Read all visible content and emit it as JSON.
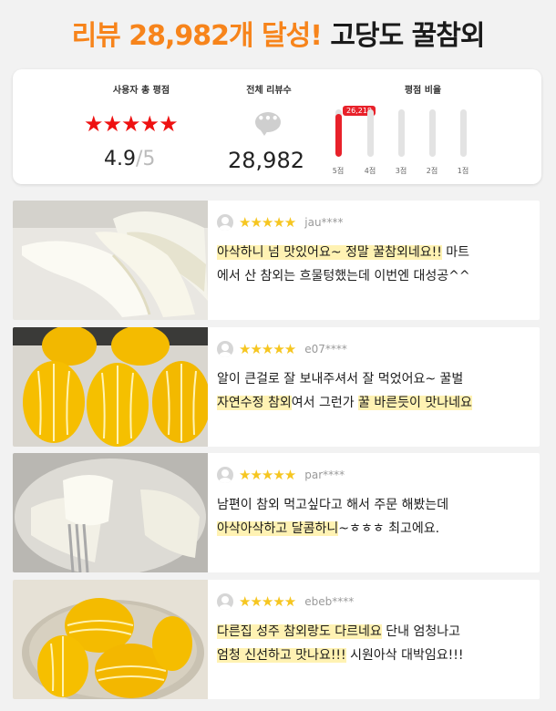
{
  "headline": {
    "accent": "리뷰 28,982개 달성!",
    "product": "고당도 꿀참외"
  },
  "summary": {
    "rating_title": "사용자 총 평점",
    "stars": "★★★★★",
    "score": "4.9",
    "score_max": "/5",
    "count_title": "전체 리뷰수",
    "count_icon_glyph": "•••",
    "review_count": "28,982",
    "ratio_title": "평점 비율",
    "top_badge": "26,218",
    "bars": [
      {
        "label": "5점",
        "fraction": 0.9
      },
      {
        "label": "4점",
        "fraction": 0
      },
      {
        "label": "3점",
        "fraction": 0
      },
      {
        "label": "2점",
        "fraction": 0
      },
      {
        "label": "1점",
        "fraction": 0
      }
    ]
  },
  "reviews": [
    {
      "stars": "★★★★★",
      "user": "jau****",
      "line1": [
        {
          "text": "아삭하니 넘 맛있어요~ 정말 꿀참외네요!!",
          "hl": true
        },
        {
          "text": " 마트",
          "hl": false
        }
      ],
      "line2": [
        {
          "text": "에서 산 참외는 흐물텅했는데 이번엔 대성공^^",
          "hl": false
        }
      ]
    },
    {
      "stars": "★★★★★",
      "user": "e07****",
      "line1": [
        {
          "text": "알이 큰걸로 잘 보내주셔서 잘 먹었어요~ 꿀벌",
          "hl": false
        }
      ],
      "line2": [
        {
          "text": "자연수정 참외",
          "hl": true
        },
        {
          "text": "여서 그런가 ",
          "hl": false
        },
        {
          "text": "꿀 바른듯이 맛나네요",
          "hl": true
        }
      ]
    },
    {
      "stars": "★★★★★",
      "user": "par****",
      "line1": [
        {
          "text": "남편이 참외 먹고싶다고 해서 주문 해봤는데",
          "hl": false
        }
      ],
      "line2": [
        {
          "text": "아삭아삭하고 달콤하니",
          "hl": true
        },
        {
          "text": "~ㅎㅎㅎ 최고에요.",
          "hl": false
        }
      ]
    },
    {
      "stars": "★★★★★",
      "user": "ebeb****",
      "line1": [
        {
          "text": "다른집 성주 참외랑도 다르네요",
          "hl": true
        },
        {
          "text": " 단내 엄청나고",
          "hl": false
        }
      ],
      "line2": [
        {
          "text": "엄청 신선하고 맛나요!!!",
          "hl": true
        },
        {
          "text": " 시원아삭 대박임요!!!",
          "hl": false
        }
      ]
    }
  ],
  "colors": {
    "accent": "#f7841b",
    "rating_red": "#e8212a",
    "star_yellow": "#f6c620",
    "highlight": "#fff2b3"
  }
}
